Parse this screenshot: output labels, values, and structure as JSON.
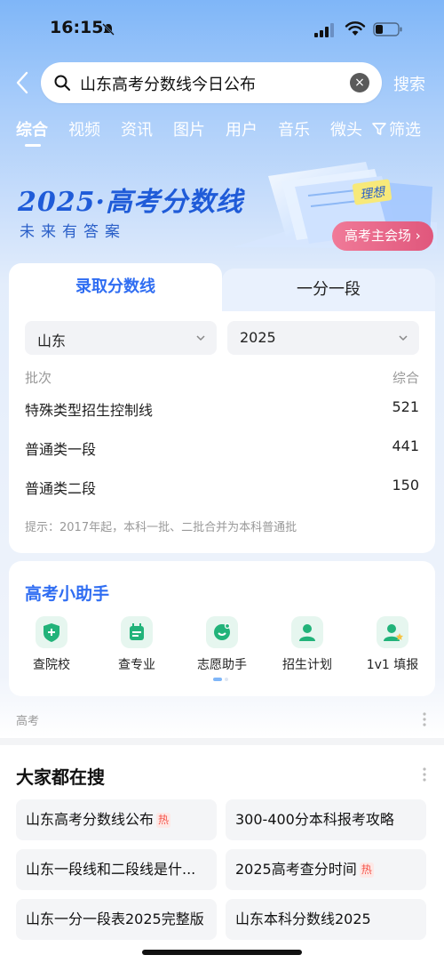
{
  "status_bar": {
    "time": "16:15"
  },
  "search": {
    "query": "山东高考分数线今日公布",
    "clear_icon": "×",
    "submit_label": "搜索"
  },
  "tabs": [
    "综合",
    "视频",
    "资讯",
    "图片",
    "用户",
    "音乐",
    "微头"
  ],
  "filter_label": "筛选",
  "banner": {
    "title": "2025·高考分数线",
    "subtitle": "未来有答案",
    "art_tag": "理想",
    "venue_button": "高考主会场 ›"
  },
  "score_card": {
    "tab_active": "录取分数线",
    "tab_inactive": "一分一段",
    "province": "山东",
    "year": "2025",
    "header_left": "批次",
    "header_right": "综合",
    "rows": [
      {
        "name": "特殊类型招生控制线",
        "value": "521"
      },
      {
        "name": "普通类一段",
        "value": "441"
      },
      {
        "name": "普通类二段",
        "value": "150"
      }
    ],
    "tip": "提示：2017年起，本科一批、二批合并为本科普通批"
  },
  "assistant": {
    "title": "高考小助手",
    "tools": [
      "查院校",
      "查专业",
      "志愿助手",
      "招生计划",
      "1v1 填报"
    ]
  },
  "section_label": "高考",
  "hot_search": {
    "title": "大家都在搜",
    "badge": "热",
    "items": [
      "山东高考分数线公布",
      "300-400分本科报考攻略",
      "山东一段线和二段线是什...",
      "2025高考查分时间",
      "山东一分一段表2025完整版",
      "山东本科分数线2025"
    ]
  },
  "colors": {
    "accent": "#2f6df2",
    "hot": "#f5544a",
    "venue": "#e0577c"
  }
}
